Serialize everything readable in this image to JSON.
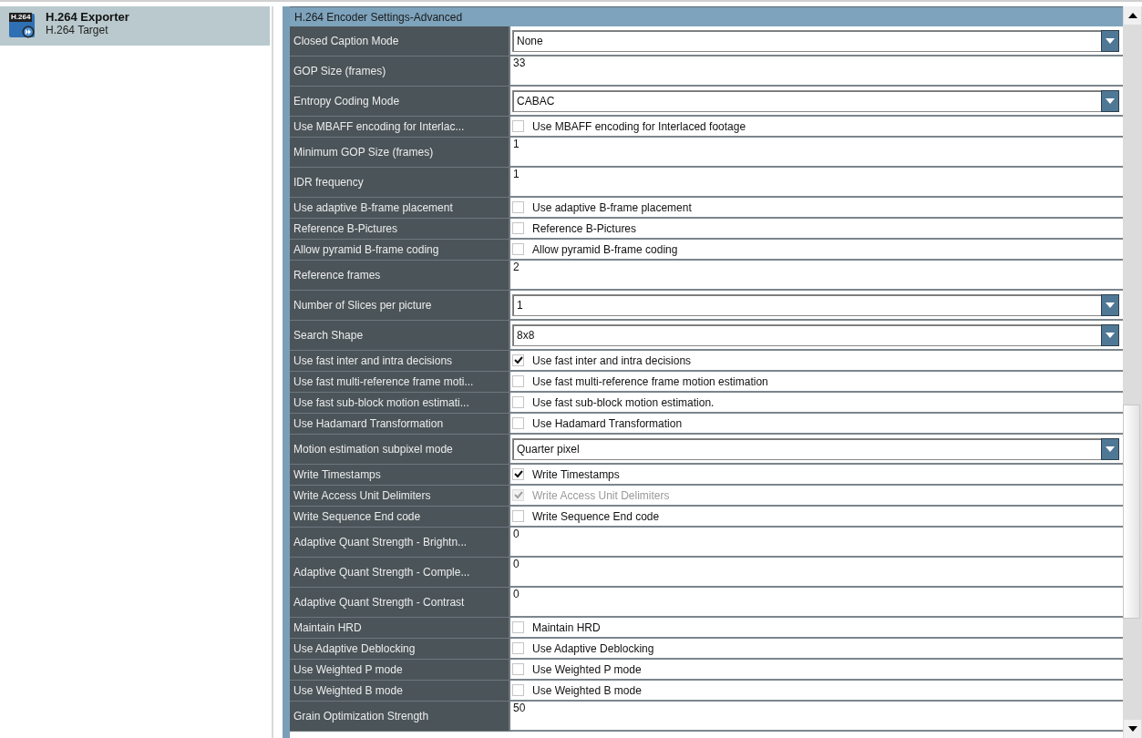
{
  "exporters": [
    {
      "badge": "H.264",
      "name": "H.264 Exporter",
      "target": "H.264 Target",
      "selected": true
    }
  ],
  "settings": {
    "title": "H.264 Encoder Settings-Advanced",
    "rows": [
      {
        "kind": "dropdown",
        "label": "Closed Caption Mode",
        "value": "None"
      },
      {
        "kind": "text",
        "label": "GOP Size (frames)",
        "value": "33"
      },
      {
        "kind": "dropdown",
        "label": "Entropy Coding Mode",
        "value": "CABAC"
      },
      {
        "kind": "checkbox",
        "label": "Use MBAFF encoding for Interlac...",
        "caption": "Use MBAFF encoding for Interlaced footage",
        "checked": false,
        "disabled": false
      },
      {
        "kind": "text",
        "label": "Minimum GOP Size (frames)",
        "value": "1"
      },
      {
        "kind": "text",
        "label": "IDR frequency",
        "value": "1"
      },
      {
        "kind": "checkbox",
        "label": "Use adaptive B-frame placement",
        "caption": "Use adaptive B-frame placement",
        "checked": false,
        "disabled": false
      },
      {
        "kind": "checkbox",
        "label": "Reference B-Pictures",
        "caption": "Reference B-Pictures",
        "checked": false,
        "disabled": false
      },
      {
        "kind": "checkbox",
        "label": "Allow pyramid B-frame coding",
        "caption": "Allow pyramid B-frame coding",
        "checked": false,
        "disabled": false
      },
      {
        "kind": "text",
        "label": "Reference frames",
        "value": "2"
      },
      {
        "kind": "dropdown",
        "label": "Number of Slices per picture",
        "value": "1"
      },
      {
        "kind": "dropdown",
        "label": "Search Shape",
        "value": "8x8"
      },
      {
        "kind": "checkbox",
        "label": "Use fast inter and intra decisions",
        "caption": "Use fast inter and intra decisions",
        "checked": true,
        "disabled": false
      },
      {
        "kind": "checkbox",
        "label": "Use fast multi-reference frame moti...",
        "caption": "Use fast multi-reference frame motion estimation",
        "checked": false,
        "disabled": false
      },
      {
        "kind": "checkbox",
        "label": "Use fast sub-block motion estimati...",
        "caption": "Use fast sub-block motion estimation.",
        "checked": false,
        "disabled": false
      },
      {
        "kind": "checkbox",
        "label": "Use Hadamard Transformation",
        "caption": "Use Hadamard Transformation",
        "checked": false,
        "disabled": false
      },
      {
        "kind": "dropdown",
        "label": "Motion estimation subpixel mode",
        "value": "Quarter pixel"
      },
      {
        "kind": "checkbox",
        "label": "Write Timestamps",
        "caption": "Write Timestamps",
        "checked": true,
        "disabled": false
      },
      {
        "kind": "checkbox",
        "label": "Write Access Unit Delimiters",
        "caption": "Write Access Unit Delimiters",
        "checked": true,
        "disabled": true
      },
      {
        "kind": "checkbox",
        "label": "Write Sequence End code",
        "caption": "Write Sequence End code",
        "checked": false,
        "disabled": false
      },
      {
        "kind": "text",
        "label": "Adaptive Quant Strength - Brightn...",
        "value": "0"
      },
      {
        "kind": "text",
        "label": "Adaptive Quant Strength - Comple...",
        "value": "0"
      },
      {
        "kind": "text",
        "label": "Adaptive Quant Strength - Contrast",
        "value": "0"
      },
      {
        "kind": "checkbox",
        "label": "Maintain HRD",
        "caption": "Maintain HRD",
        "checked": false,
        "disabled": false
      },
      {
        "kind": "checkbox",
        "label": "Use Adaptive Deblocking",
        "caption": "Use Adaptive Deblocking",
        "checked": false,
        "disabled": false
      },
      {
        "kind": "checkbox",
        "label": "Use Weighted P mode",
        "caption": "Use Weighted P mode",
        "checked": false,
        "disabled": false
      },
      {
        "kind": "checkbox",
        "label": "Use Weighted B mode",
        "caption": "Use Weighted B mode",
        "checked": false,
        "disabled": false
      },
      {
        "kind": "text",
        "label": "Grain Optimization Strength",
        "value": "50"
      }
    ]
  }
}
